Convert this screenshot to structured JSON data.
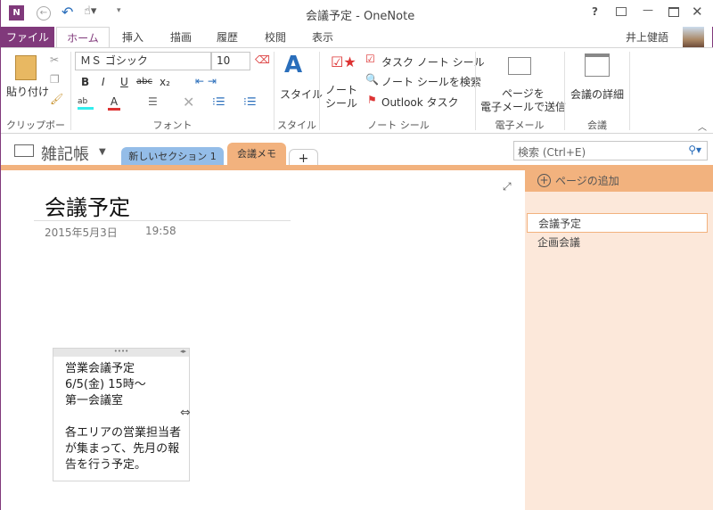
{
  "window": {
    "title": "会議予定 - OneNote",
    "help": "?",
    "user": "井上健語"
  },
  "ribbon_tabs": [
    "ファイル",
    "ホーム",
    "挿入",
    "描画",
    "履歴",
    "校閲",
    "表示"
  ],
  "clipboard": {
    "paste": "貼り付け",
    "label": "クリップボード"
  },
  "font": {
    "name": "ＭＳ ゴシック",
    "size": "10",
    "label": "フォント",
    "bold": "B",
    "italic": "I",
    "underline": "U",
    "strike": "abc",
    "sub": "x₂"
  },
  "style": {
    "button": "スタイル",
    "label": "スタイル"
  },
  "tags": {
    "note_tag": "ノート\nシール",
    "task": "タスク ノート シール",
    "find": "ノート シールを検索",
    "outlook": "Outlook タスク",
    "label": "ノート シール"
  },
  "email": {
    "button_line1": "ページを",
    "button_line2": "電子メールで送信",
    "label": "電子メール"
  },
  "meeting": {
    "button": "会議の詳細",
    "label": "会議"
  },
  "notebook": {
    "name": "雑記帳",
    "sections": [
      "新しいセクション 1",
      "会議メモ"
    ],
    "add": "+"
  },
  "search": {
    "placeholder": "検索 (Ctrl+E)"
  },
  "page": {
    "title": "会議予定",
    "date": "2015年5月3日",
    "time": "19:58"
  },
  "note": {
    "lines": [
      "営業会議予定",
      "6/5(金) 15時～",
      "第一会議室",
      "",
      "各エリアの営業担当者",
      "が集まって、先月の報",
      "告を行う予定。"
    ]
  },
  "pages_pane": {
    "add": "ページの追加",
    "pages": [
      "会議予定",
      "企画会議"
    ]
  }
}
